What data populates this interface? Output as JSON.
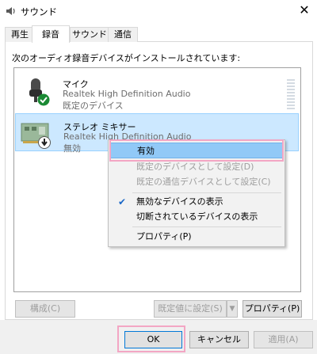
{
  "window": {
    "title": "サウンド",
    "close_glyph": "✕"
  },
  "tabs": [
    {
      "label": "再生"
    },
    {
      "label": "録音"
    },
    {
      "label": "サウンド"
    },
    {
      "label": "通信"
    }
  ],
  "prompt": "次のオーディオ録音デバイスがインストールされています:",
  "devices": [
    {
      "name": "マイク",
      "driver": "Realtek High Definition Audio",
      "status": "既定のデバイス",
      "icon": "microphone-icon",
      "badge": "check-badge-icon"
    },
    {
      "name": "ステレオ ミキサー",
      "driver": "Realtek High Definition Audio",
      "status": "無効",
      "icon": "sound-card-icon",
      "badge": "down-arrow-badge-icon"
    }
  ],
  "context_menu": {
    "items": [
      {
        "label": "有効",
        "state": "highlighted"
      },
      {
        "label": "既定のデバイスとして設定(D)",
        "state": "disabled"
      },
      {
        "label": "既定の通信デバイスとして設定(C)",
        "state": "disabled"
      },
      {
        "label": "無効なデバイスの表示",
        "state": "checked"
      },
      {
        "label": "切断されているデバイスの表示",
        "state": "normal"
      },
      {
        "label": "プロパティ(P)",
        "state": "normal"
      }
    ]
  },
  "buttons": {
    "configure": "構成(C)",
    "set_default": "既定値に設定(S)",
    "properties": "プロパティ(P)",
    "ok": "OK",
    "cancel": "キャンセル",
    "apply": "適用(A)"
  },
  "colors": {
    "highlight_pink": "#f3a6c4",
    "selection_blue": "#cce8ff",
    "menu_highlight": "#91c9f7",
    "check_green": "#1a8a34"
  }
}
